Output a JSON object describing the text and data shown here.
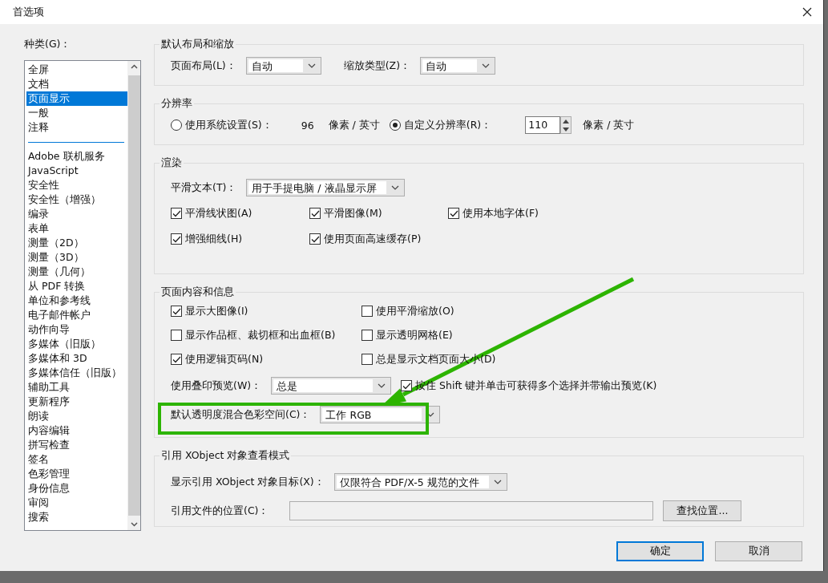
{
  "window": {
    "title": "首选项"
  },
  "categories": {
    "label": "种类(G)：",
    "groups": [
      [
        {
          "label": "全屏",
          "selected": false
        },
        {
          "label": "文档",
          "selected": false
        },
        {
          "label": "页面显示",
          "selected": true
        },
        {
          "label": "一般",
          "selected": false
        },
        {
          "label": "注释",
          "selected": false
        }
      ],
      [
        {
          "label": "Adobe 联机服务",
          "selected": false
        },
        {
          "label": "JavaScript",
          "selected": false
        },
        {
          "label": "安全性",
          "selected": false
        },
        {
          "label": "安全性（增强）",
          "selected": false
        },
        {
          "label": "编录",
          "selected": false
        },
        {
          "label": "表单",
          "selected": false
        },
        {
          "label": "测量（2D）",
          "selected": false
        },
        {
          "label": "测量（3D）",
          "selected": false
        },
        {
          "label": "测量（几何）",
          "selected": false
        },
        {
          "label": "从 PDF 转换",
          "selected": false
        },
        {
          "label": "单位和参考线",
          "selected": false
        },
        {
          "label": "电子邮件帐户",
          "selected": false
        },
        {
          "label": "动作向导",
          "selected": false
        },
        {
          "label": "多媒体（旧版）",
          "selected": false
        },
        {
          "label": "多媒体和 3D",
          "selected": false
        },
        {
          "label": "多媒体信任（旧版）",
          "selected": false
        },
        {
          "label": "辅助工具",
          "selected": false
        },
        {
          "label": "更新程序",
          "selected": false
        },
        {
          "label": "朗读",
          "selected": false
        },
        {
          "label": "内容编辑",
          "selected": false
        },
        {
          "label": "拼写检查",
          "selected": false
        },
        {
          "label": "签名",
          "selected": false
        },
        {
          "label": "色彩管理",
          "selected": false
        },
        {
          "label": "身份信息",
          "selected": false
        },
        {
          "label": "审阅",
          "selected": false
        },
        {
          "label": "搜索",
          "selected": false
        }
      ]
    ]
  },
  "sections": [
    {
      "title": "默认布局和缩放",
      "rows": [
        [
          {
            "kind": "dropdown",
            "label": "页面布局(L)：",
            "value": "自动"
          },
          {
            "kind": "dropdown",
            "label": "缩放类型(Z)：",
            "value": "自动"
          }
        ]
      ]
    },
    {
      "title": "分辨率",
      "rows": [
        [
          {
            "kind": "radio",
            "label": "使用系统设置(S)：",
            "selected": false
          },
          {
            "kind": "text",
            "text": "96"
          },
          {
            "kind": "text",
            "text": "像素 / 英寸"
          },
          {
            "kind": "radio",
            "label": "自定义分辨率(R)：",
            "selected": true
          },
          {
            "kind": "spinner",
            "value": "110"
          },
          {
            "kind": "text",
            "text": "像素 / 英寸"
          }
        ]
      ]
    },
    {
      "title": "渲染",
      "rows": [
        [
          {
            "kind": "dropdown",
            "label": "平滑文本(T)：",
            "value": "用于手提电脑 / 液晶显示屏"
          }
        ],
        [
          {
            "kind": "checkbox",
            "label": "平滑线状图(A)",
            "checked": true
          },
          {
            "kind": "checkbox",
            "label": "平滑图像(M)",
            "checked": true
          },
          {
            "kind": "checkbox",
            "label": "使用本地字体(F)",
            "checked": true
          }
        ],
        [
          {
            "kind": "checkbox",
            "label": "增强细线(H)",
            "checked": true
          },
          {
            "kind": "checkbox",
            "label": "使用页面高速缓存(P)",
            "checked": true
          }
        ]
      ]
    },
    {
      "title": "页面内容和信息",
      "rows": [
        [
          {
            "kind": "checkbox",
            "label": "显示大图像(I)",
            "checked": true
          },
          {
            "kind": "checkbox",
            "label": "使用平滑缩放(O)",
            "checked": false
          }
        ],
        [
          {
            "kind": "checkbox",
            "label": "显示作品框、裁切框和出血框(B)",
            "checked": false
          },
          {
            "kind": "checkbox",
            "label": "显示透明网格(E)",
            "checked": false
          }
        ],
        [
          {
            "kind": "checkbox",
            "label": "使用逻辑页码(N)",
            "checked": true
          },
          {
            "kind": "checkbox",
            "label": "总是显示文档页面大小(D)",
            "checked": false
          }
        ],
        [
          {
            "kind": "dropdown",
            "label": "使用叠印预览(W)：",
            "value": "总是"
          },
          {
            "kind": "checkbox",
            "label": "按住 Shift 键并单击可获得多个选择并带输出预览(K)",
            "checked": true
          }
        ],
        [
          {
            "kind": "dropdown",
            "label": "默认透明度混合色彩空间(C)：",
            "value": "工作 RGB"
          }
        ]
      ]
    },
    {
      "title": "引用 XObject 对象查看模式",
      "rows": [
        [
          {
            "kind": "dropdown",
            "label": "显示引用 XObject 对象目标(X)：",
            "value": "仅限符合 PDF/X-5 规范的文件"
          }
        ],
        [
          {
            "kind": "field",
            "label": "引用文件的位置(C)："
          },
          {
            "kind": "button",
            "label": "查找位置..."
          }
        ]
      ]
    }
  ],
  "buttons": [
    {
      "label": "确定",
      "default": true
    },
    {
      "label": "取消",
      "default": false
    }
  ]
}
